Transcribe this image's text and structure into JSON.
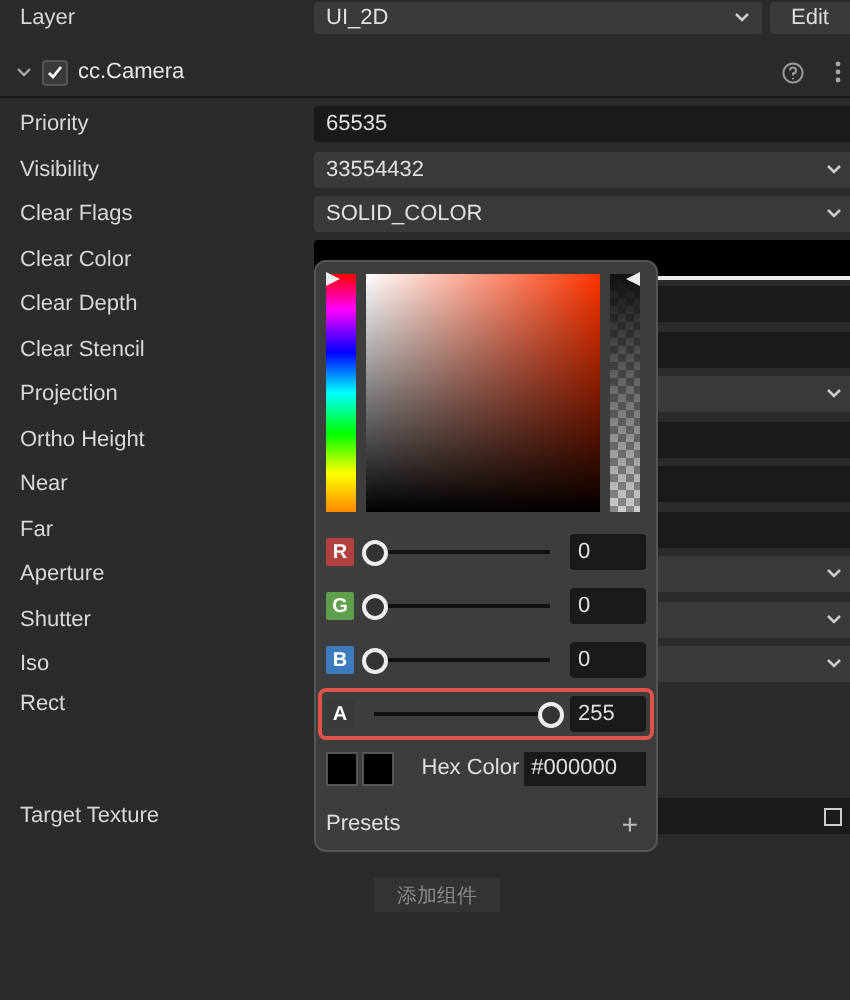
{
  "layer": {
    "label": "Layer",
    "value": "UI_2D",
    "button": "Edit"
  },
  "component": {
    "title": "cc.Camera",
    "enabled": true,
    "expanded": true
  },
  "properties": [
    {
      "label": "Priority",
      "kind": "input",
      "value": "65535"
    },
    {
      "label": "Visibility",
      "kind": "select",
      "value": "33554432"
    },
    {
      "label": "Clear Flags",
      "kind": "select",
      "value": "SOLID_COLOR"
    },
    {
      "label": "Clear Color",
      "kind": "color"
    },
    {
      "label": "Clear Depth",
      "kind": "input"
    },
    {
      "label": "Clear Stencil",
      "kind": "input"
    },
    {
      "label": "Projection",
      "kind": "select"
    },
    {
      "label": "Ortho Height",
      "kind": "input"
    },
    {
      "label": "Near",
      "kind": "input"
    },
    {
      "label": "Far",
      "kind": "input"
    },
    {
      "label": "Aperture",
      "kind": "select"
    },
    {
      "label": "Shutter",
      "kind": "select"
    },
    {
      "label": "Iso",
      "kind": "select"
    },
    {
      "label": "Rect",
      "kind": "rect"
    },
    {
      "label": "Target Texture",
      "kind": "asset"
    }
  ],
  "color_picker": {
    "hue_slider": {
      "level": 1
    },
    "alpha_slider": {
      "level": 1
    },
    "channels": [
      {
        "label": "R",
        "level": 0,
        "value": "0",
        "color": "#b0413e",
        "highlighted": false
      },
      {
        "label": "G",
        "level": 0,
        "value": "0",
        "color": "#5f9e4a",
        "highlighted": false
      },
      {
        "label": "B",
        "level": 0,
        "value": "0",
        "color": "#3d7bbf",
        "highlighted": false
      },
      {
        "label": "A",
        "level": 1,
        "value": "255",
        "color": "#3a3a3a",
        "highlighted": true
      }
    ],
    "hex_label": "Hex Color",
    "hex_value": "#000000",
    "presets_label": "Presets",
    "add_preset": "+"
  },
  "add_component_button": "添加组件"
}
